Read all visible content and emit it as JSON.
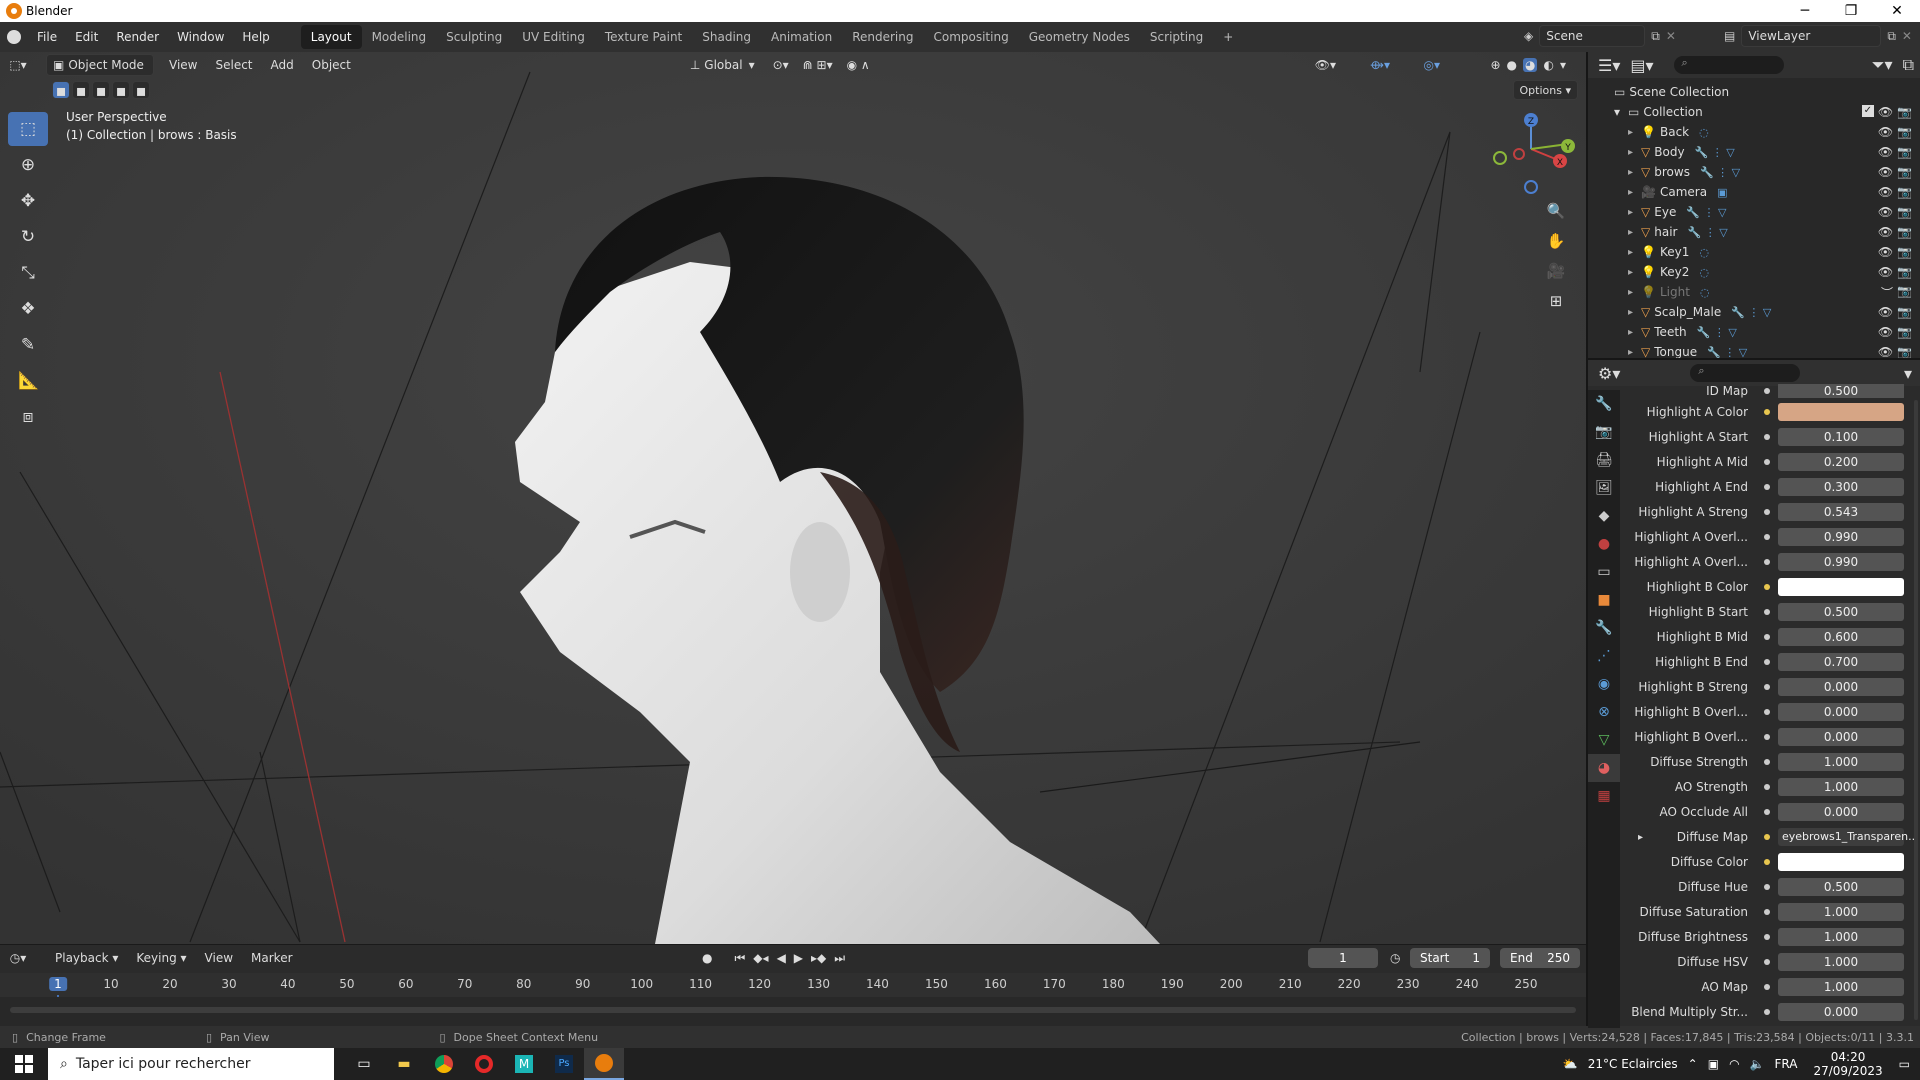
{
  "window": {
    "title": "Blender"
  },
  "menu": [
    "File",
    "Edit",
    "Render",
    "Window",
    "Help"
  ],
  "workspaces": [
    {
      "label": "Layout",
      "active": true
    },
    {
      "label": "Modeling"
    },
    {
      "label": "Sculpting"
    },
    {
      "label": "UV Editing"
    },
    {
      "label": "Texture Paint"
    },
    {
      "label": "Shading"
    },
    {
      "label": "Animation"
    },
    {
      "label": "Rendering"
    },
    {
      "label": "Compositing"
    },
    {
      "label": "Geometry Nodes"
    },
    {
      "label": "Scripting"
    }
  ],
  "scene": {
    "name": "Scene",
    "view_layer": "ViewLayer"
  },
  "viewport": {
    "mode": "Object Mode",
    "menus": [
      "View",
      "Select",
      "Add",
      "Object"
    ],
    "orientation": "Global",
    "options_label": "Options",
    "info_line1": "User Perspective",
    "info_line2": "(1) Collection | brows : Basis",
    "gizmo_axes": {
      "x": "X",
      "y": "Y",
      "z": "Z"
    }
  },
  "outliner": {
    "root": "Scene Collection",
    "collection": "Collection",
    "items": [
      {
        "name": "Back",
        "type": "light-object"
      },
      {
        "name": "Body",
        "type": "mesh"
      },
      {
        "name": "brows",
        "type": "mesh"
      },
      {
        "name": "Camera",
        "type": "camera"
      },
      {
        "name": "Eye",
        "type": "mesh"
      },
      {
        "name": "hair",
        "type": "mesh"
      },
      {
        "name": "Key1",
        "type": "light-object"
      },
      {
        "name": "Key2",
        "type": "light-object"
      },
      {
        "name": "Light",
        "type": "light-object",
        "disabled": true
      },
      {
        "name": "Scalp_Male",
        "type": "mesh"
      },
      {
        "name": "Teeth",
        "type": "mesh"
      },
      {
        "name": "Tongue",
        "type": "mesh"
      }
    ]
  },
  "properties": {
    "top_partial": {
      "label": "ID Map",
      "value": "0.500"
    },
    "rows": [
      {
        "label": "Highlight A Color",
        "value": "",
        "color": "#d6a585"
      },
      {
        "label": "Highlight A Start",
        "value": "0.100"
      },
      {
        "label": "Highlight A Mid",
        "value": "0.200"
      },
      {
        "label": "Highlight A End",
        "value": "0.300"
      },
      {
        "label": "Highlight A Streng",
        "value": "0.543"
      },
      {
        "label": "Highlight A Overl...",
        "value": "0.990"
      },
      {
        "label": "Highlight A Overl...",
        "value": "0.990"
      },
      {
        "label": "Highlight B Color",
        "value": "",
        "color": "#ffffff"
      },
      {
        "label": "Highlight B Start",
        "value": "0.500"
      },
      {
        "label": "Highlight B Mid",
        "value": "0.600"
      },
      {
        "label": "Highlight B End",
        "value": "0.700"
      },
      {
        "label": "Highlight B Streng",
        "value": "0.000"
      },
      {
        "label": "Highlight B Overl...",
        "value": "0.000"
      },
      {
        "label": "Highlight B Overl...",
        "value": "0.000"
      },
      {
        "label": "Diffuse Strength",
        "value": "1.000"
      },
      {
        "label": "AO Strength",
        "value": "1.000"
      },
      {
        "label": "AO Occlude All",
        "value": "0.000"
      },
      {
        "label": "Diffuse Map",
        "value": "eyebrows1_Transparen...",
        "expandable": true
      },
      {
        "label": "Diffuse Color",
        "value": "",
        "color": "#ffffff"
      },
      {
        "label": "Diffuse Hue",
        "value": "0.500"
      },
      {
        "label": "Diffuse Saturation",
        "value": "1.000"
      },
      {
        "label": "Diffuse Brightness",
        "value": "1.000"
      },
      {
        "label": "Diffuse HSV",
        "value": "1.000"
      },
      {
        "label": "AO Map",
        "value": "1.000"
      },
      {
        "label": "Blend Multiply Str...",
        "value": "0.000"
      }
    ]
  },
  "timeline": {
    "menus": [
      "Playback",
      "Keying",
      "View",
      "Marker"
    ],
    "current_frame": "1",
    "start_label": "Start",
    "start": "1",
    "end_label": "End",
    "end": "250",
    "ruler": [
      "1",
      "10",
      "20",
      "30",
      "40",
      "50",
      "60",
      "70",
      "80",
      "90",
      "100",
      "110",
      "120",
      "130",
      "140",
      "150",
      "160",
      "170",
      "180",
      "190",
      "200",
      "210",
      "220",
      "230",
      "240",
      "250"
    ]
  },
  "status": {
    "left1": "Change Frame",
    "left2": "Pan View",
    "left3": "Dope Sheet Context Menu",
    "right": "Collection | brows | Verts:24,528 | Faces:17,845 | Tris:23,584 | Objects:0/11 | 3.3.1"
  },
  "taskbar": {
    "search_placeholder": "Taper ici pour rechercher",
    "weather": "21°C  Eclaircies",
    "lang": "FRA",
    "time": "04:20",
    "date": "27/09/2023"
  }
}
